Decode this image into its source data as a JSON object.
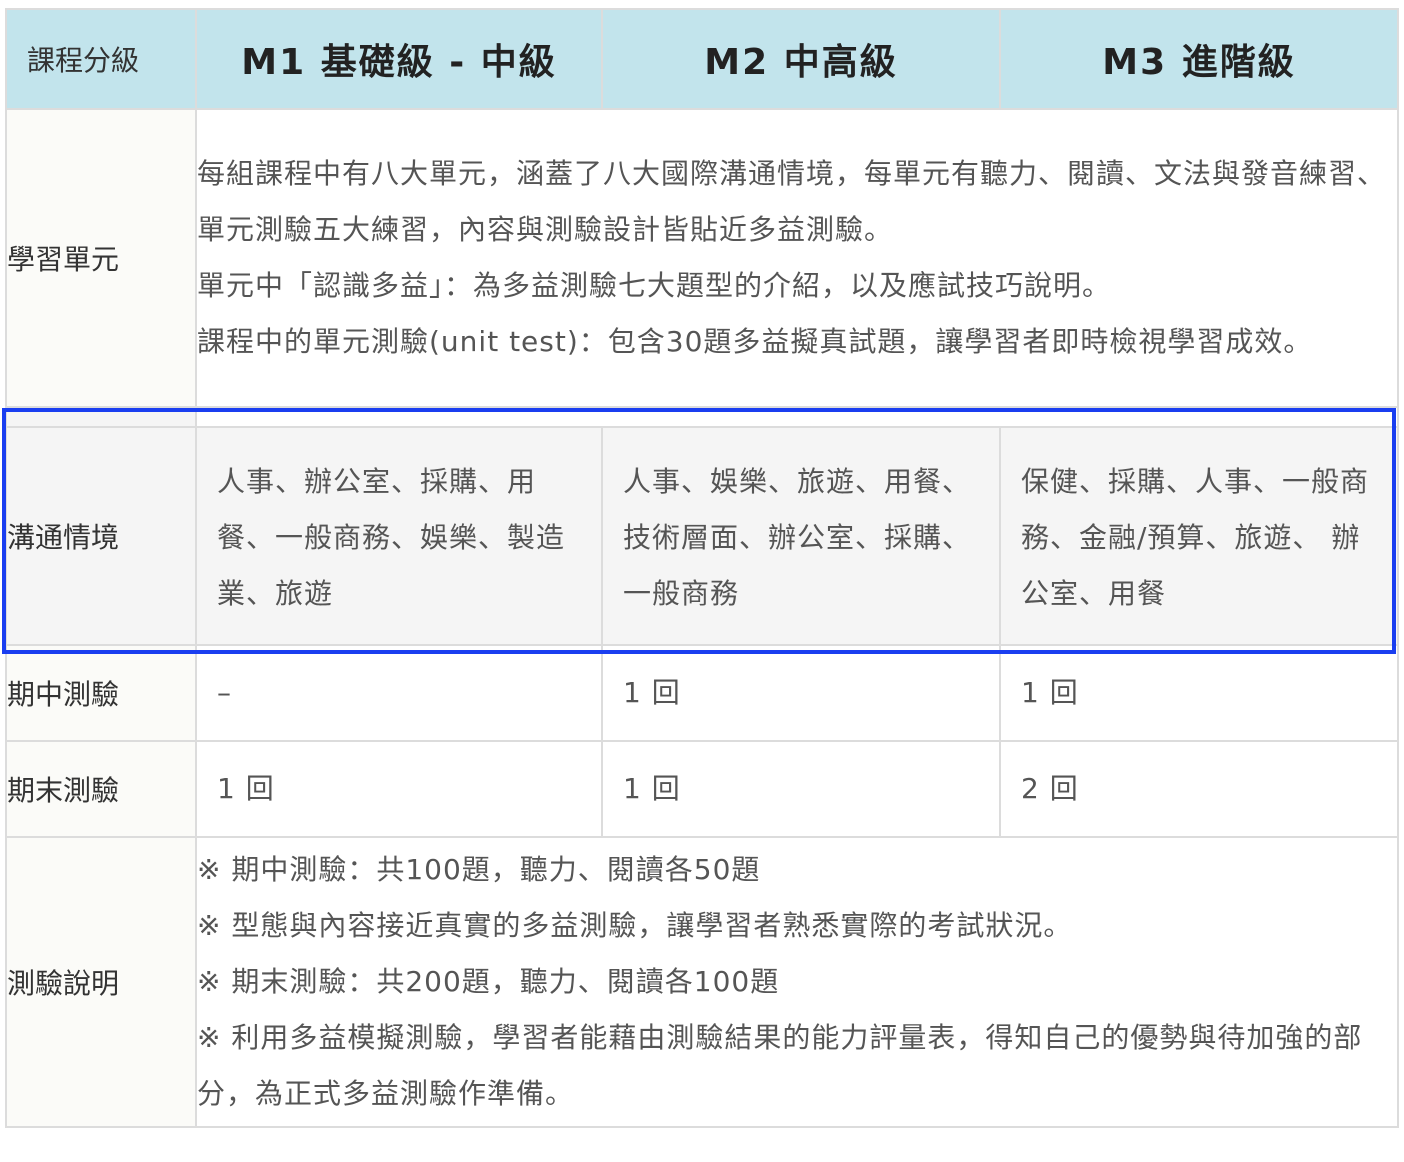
{
  "header": {
    "label": "課程分級",
    "m1": "M1 基礎級 - 中級",
    "m2": "M2 中高級",
    "m3": "M3 進階級"
  },
  "units": {
    "label": "學習單元",
    "lines": [
      "每組課程中有八大單元，涵蓋了八大國際溝通情境，每單元有聽力、閱讀、文法與發音練習、單元測驗五大練習，內容與測驗設計皆貼近多益測驗。",
      "單元中「認識多益」：為多益測驗七大題型的介紹，以及應試技巧說明。",
      "課程中的單元測驗(unit test)：包含30題多益擬真試題，讓學習者即時檢視學習成效。"
    ]
  },
  "scenarios": {
    "label": "溝通情境",
    "m1": "人事、辦公室、採購、用餐、一般商務、娛樂、製造業、旅遊",
    "m2": "人事、娛樂、旅遊、用餐、技術層面、辦公室、採購、一般商務",
    "m3": "保健、採購、人事、一般商務、金融/預算、旅遊、 辦公室、用餐"
  },
  "midterm": {
    "label": "期中測驗",
    "m1": "–",
    "m2": "1 回",
    "m3": "1 回"
  },
  "final": {
    "label": "期末測驗",
    "m1": "1 回",
    "m2": "1 回",
    "m3": "2 回"
  },
  "notes": {
    "label": "測驗說明",
    "lines": [
      "※ 期中測驗：共100題，聽力、閱讀各50題",
      "※ 型態與內容接近真實的多益測驗，讓學習者熟悉實際的考試狀況。",
      "※ 期末測驗：共200題，聽力、閱讀各100題",
      "※ 利用多益模擬測驗，學習者能藉由測驗結果的能力評量表，得知自己的優勢與待加強的部分，為正式多益測驗作準備。"
    ]
  }
}
